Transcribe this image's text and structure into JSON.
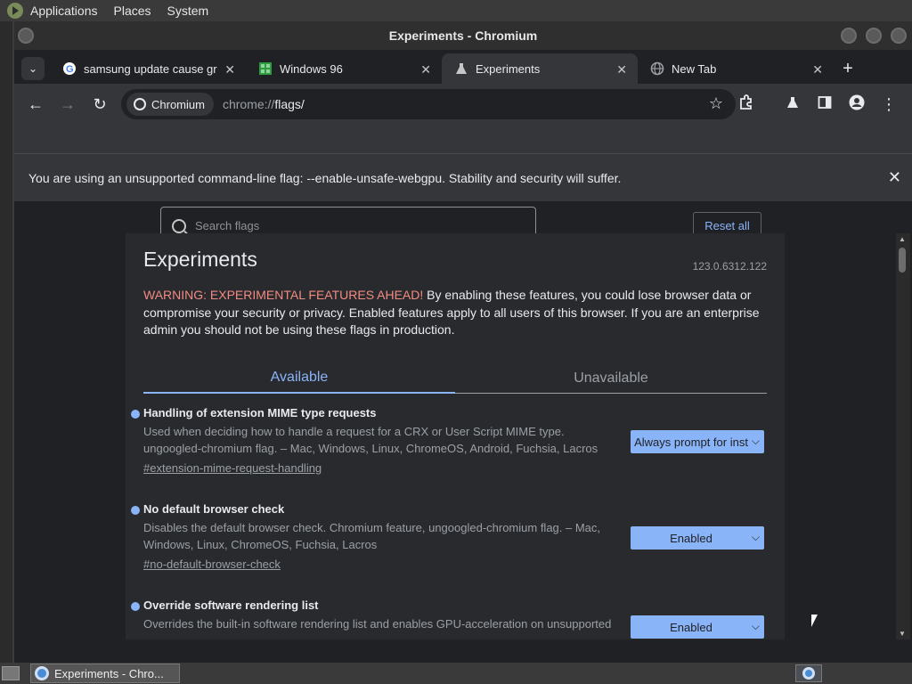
{
  "system_panel": {
    "menus": [
      "Applications",
      "Places",
      "System"
    ]
  },
  "window": {
    "title": "Experiments - Chromium"
  },
  "tabs": [
    {
      "label": "samsung update cause gr",
      "icon": "google-icon"
    },
    {
      "label": "Windows 96",
      "icon": "windows96-icon"
    },
    {
      "label": "Experiments",
      "icon": "flask-icon",
      "active": true
    },
    {
      "label": "New Tab",
      "icon": "globe-icon"
    }
  ],
  "toolbar": {
    "chip_label": "Chromium",
    "url_scheme": "chrome://",
    "url_path": "flags/"
  },
  "infobar": {
    "message": "You are using an unsupported command-line flag: --enable-unsafe-webgpu. Stability and security will suffer."
  },
  "flags_header": {
    "search_placeholder": "Search flags",
    "reset_label": "Reset all"
  },
  "experiments": {
    "title": "Experiments",
    "version": "123.0.6312.122",
    "warning_prefix": "WARNING: EXPERIMENTAL FEATURES AHEAD!",
    "warning_body": " By enabling these features, you could lose browser data or compromise your security or privacy. Enabled features apply to all users of this browser. If you are an enterprise admin you should not be using these flags in production.",
    "tab_available": "Available",
    "tab_unavailable": "Unavailable",
    "flags": [
      {
        "name": "Handling of extension MIME type requests",
        "description": "Used when deciding how to handle a request for a CRX or User Script MIME type. ungoogled-chromium flag. – Mac, Windows, Linux, ChromeOS, Android, Fuchsia, Lacros",
        "link": "#extension-mime-request-handling",
        "value": "Always prompt for inst"
      },
      {
        "name": "No default browser check",
        "description": "Disables the default browser check. Chromium feature, ungoogled-chromium flag. – Mac, Windows, Linux, ChromeOS, Fuchsia, Lacros",
        "link": "#no-default-browser-check",
        "value": "Enabled"
      },
      {
        "name": "Override software rendering list",
        "description": "Overrides the built-in software rendering list and enables GPU-acceleration on unsupported",
        "value": "Enabled"
      }
    ]
  },
  "taskbar": {
    "task_label": "Experiments - Chro..."
  },
  "colors": {
    "accent": "#8ab4f8",
    "warning": "#f28b82",
    "background": "#202124",
    "card": "#292a2d"
  }
}
